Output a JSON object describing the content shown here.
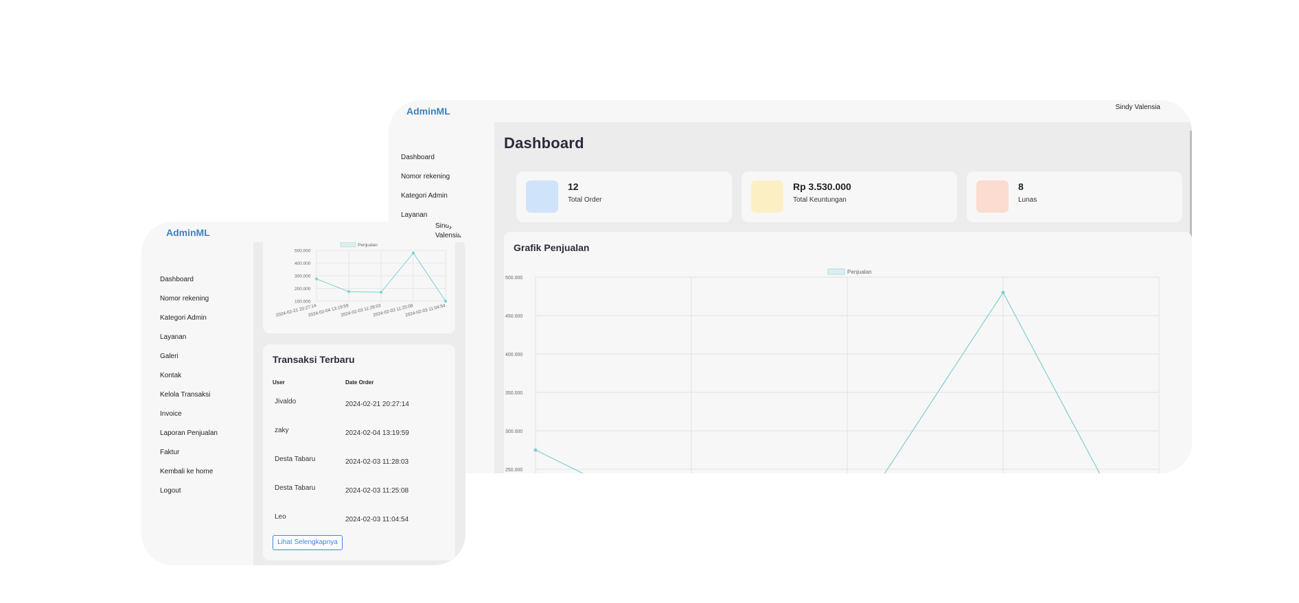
{
  "brand": "AdminML",
  "user_name": "Sindy Valensia",
  "nav_items": [
    "Dashboard",
    "Nomor rekening",
    "Kategori Admin",
    "Layanan",
    "Galeri",
    "Kontak",
    "Kelola Transaksi",
    "Invoice",
    "Laporan Penjualan",
    "Faktur",
    "Kembali ke home",
    "Logout"
  ],
  "page_title": "Dashboard",
  "stats": [
    {
      "value": "12",
      "label": "Total Order",
      "color": "#cfe3fb"
    },
    {
      "value": "Rp 3.530.000",
      "label": "Total Keuntungan",
      "color": "#fcefc4"
    },
    {
      "value": "8",
      "label": "Lunas",
      "color": "#fcdcd0"
    }
  ],
  "sales_chart_title": "Grafik Penjualan",
  "transactions": {
    "title": "Transaksi Terbaru",
    "columns": [
      "User",
      "Date Order"
    ],
    "rows": [
      {
        "user": "Jivaldo",
        "date": "2024-02-21 20:27:14"
      },
      {
        "user": "zaky",
        "date": "2024-02-04 13:19:59"
      },
      {
        "user": "Desta Tabaru",
        "date": "2024-02-03 11:28:03"
      },
      {
        "user": "Desta Tabaru",
        "date": "2024-02-03 11:25:08"
      },
      {
        "user": "Leo",
        "date": "2024-02-03 11:04:54"
      }
    ],
    "button_label": "Lihat Selengkapnya"
  },
  "chart_data": {
    "type": "line",
    "title": "",
    "xlabel": "",
    "ylabel": "",
    "categories": [
      "2024-02-21 20:27:14",
      "2024-02-04 13:19:59",
      "2024-02-03 11:28:03",
      "2024-02-03 11:25:08",
      "2024-02-03 11:04:54"
    ],
    "series": [
      {
        "name": "Penjualan",
        "values": [
          275000,
          175000,
          170000,
          480000,
          100000
        ],
        "color": "#7ccfd1"
      }
    ],
    "y_ticks": [
      "100.000",
      "200.000",
      "300.000",
      "400.000",
      "500.000"
    ],
    "y_ticks_large": [
      "250.000",
      "300.000",
      "350.000",
      "400.000",
      "450.000",
      "500.000"
    ],
    "ylim": [
      100000,
      500000
    ],
    "grid": true,
    "legend_position": "top"
  }
}
